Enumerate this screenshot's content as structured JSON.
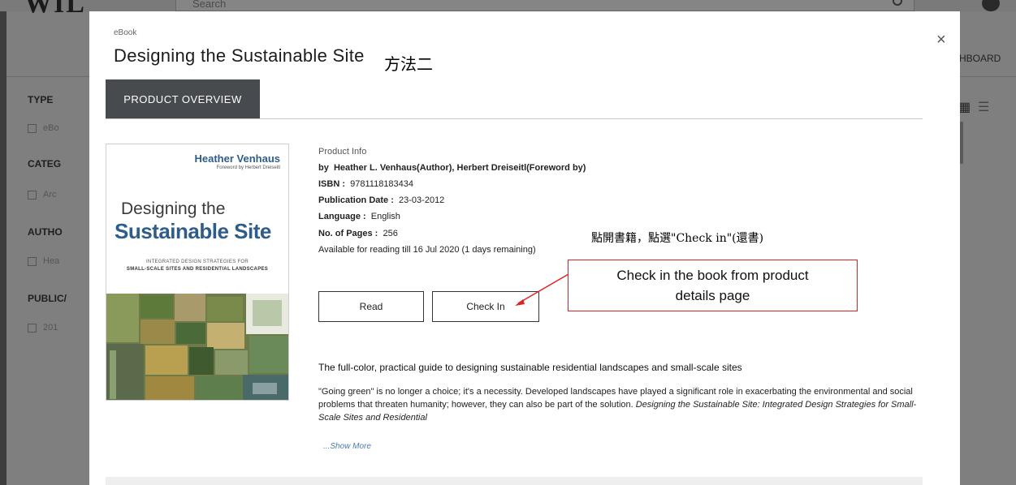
{
  "background": {
    "logo": "WIL",
    "search_placeholder": "Search",
    "dashboard_label": "HBOARD",
    "filters": [
      {
        "title": "TYPE",
        "item": "eBo"
      },
      {
        "title": "CATEG",
        "item": "Arc"
      },
      {
        "title": "AUTHO",
        "item": "Hea"
      },
      {
        "title": "PUBLIC/",
        "item": "201"
      }
    ]
  },
  "modal": {
    "type_label": "eBook",
    "title": "Designing the Sustainable Site",
    "close_symbol": "×",
    "tab_label": "PRODUCT OVERVIEW",
    "cover": {
      "author": "Heather Venhaus",
      "foreword": "Foreword by Herbert Dreiseitl",
      "title_line1": "Designing the",
      "title_line2": "Sustainable Site",
      "subtitle_line1": "INTEGRATED DESIGN STRATEGIES FOR",
      "subtitle_line2": "SMALL-SCALE SITES AND RESIDENTIAL LANDSCAPES"
    },
    "info": {
      "heading": "Product Info",
      "by_prefix": "by",
      "authors": "Heather L. Venhaus(Author), Herbert Dreiseitl(Foreword by)",
      "isbn_label": "ISBN :",
      "isbn": "9781118183434",
      "pubdate_label": "Publication Date :",
      "pubdate": "23-03-2012",
      "language_label": "Language :",
      "language": "English",
      "pages_label": "No. of Pages :",
      "pages": "256",
      "availability": "Available for reading till 16 Jul 2020 (1 days remaining)"
    },
    "buttons": {
      "read": "Read",
      "check_in": "Check In"
    },
    "description": {
      "headline": "The full-color, practical guide to designing sustainable residential landscapes and small-scale sites",
      "body": "\"Going green\" is no longer a choice; it's a necessity. Developed landscapes have played a significant role in exacerbating the environmental and social problems that threaten humanity; however, they can also be part of the solution.",
      "body_italic": "Designing the Sustainable Site: Integrated Design Strategies for Small-Scale Sites and Residential",
      "show_more": "...Show More"
    }
  },
  "annotations": {
    "method": "方法二",
    "checkin_instruction": "點開書籍，點選\"Check in\"(還書)",
    "callout_line1": "Check in the book from product",
    "callout_line2": "details page",
    "callout_color": "#dd2222"
  }
}
